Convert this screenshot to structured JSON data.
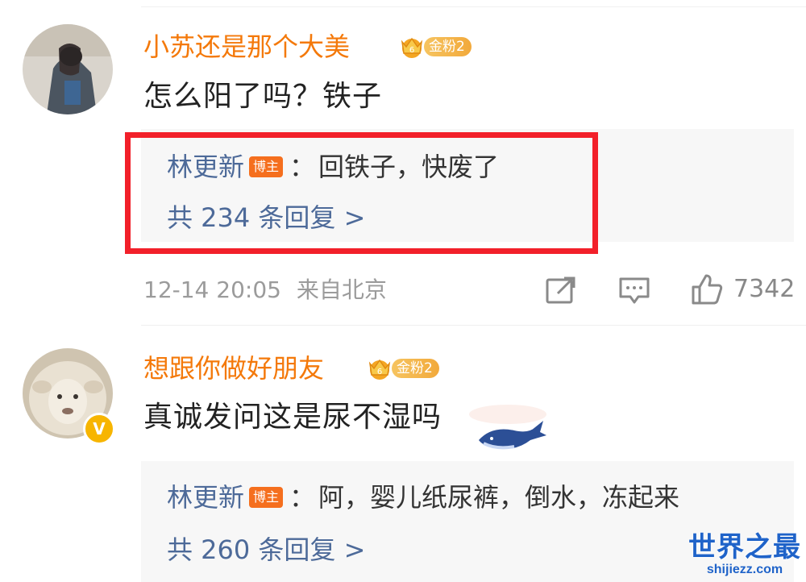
{
  "comments": [
    {
      "username": "小苏还是那个大美",
      "fan_badge": "金粉2",
      "text": "怎么阳了吗？铁子",
      "reply": {
        "author": "林更新",
        "author_tag": "博主",
        "colon": "：",
        "text": "回铁子，快废了",
        "count_label": "共 234 条回复 >"
      },
      "meta": {
        "time": "12-14 20:05",
        "location": "来自北京",
        "like_count": "7342"
      },
      "highlighted": true
    },
    {
      "username": "想跟你做好朋友",
      "fan_badge": "金粉2",
      "text": "真诚发问这是尿不湿吗",
      "verified_badge": "V",
      "reply": {
        "author": "林更新",
        "author_tag": "博主",
        "colon": "：",
        "text": "阿，婴儿纸尿裤，倒水，冻起来",
        "count_label": "共 260 条回复 >"
      }
    }
  ],
  "icons": [
    "repost-icon",
    "comment-icon",
    "like-icon",
    "crown-icon",
    "whale-sticker"
  ],
  "watermark": {
    "title": "世界之最",
    "url": "shijiezz.com"
  },
  "colors": {
    "username": "#f4790a",
    "reply_author": "#4d6a99",
    "highlight": "#f2202a",
    "blogger_tag": "#f56f1e"
  }
}
